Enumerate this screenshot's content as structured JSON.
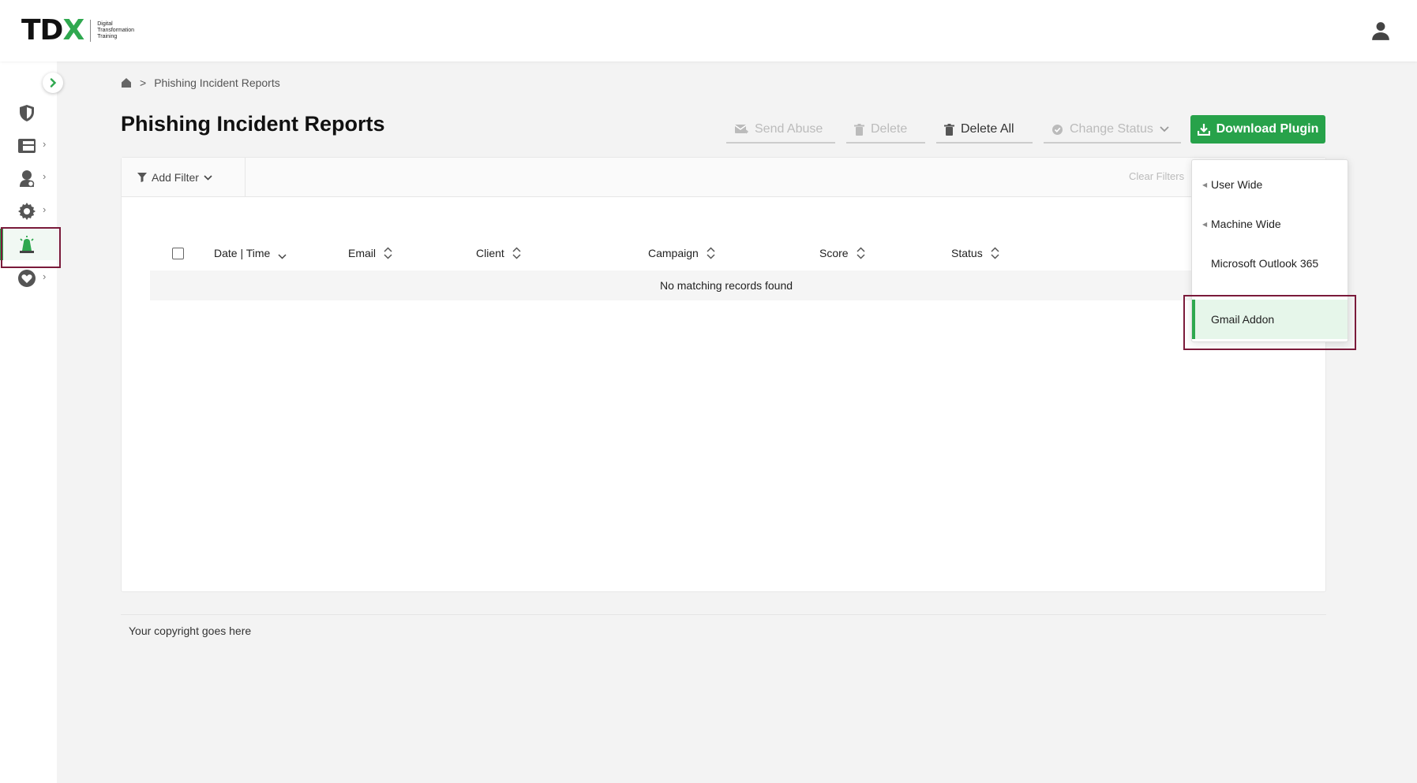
{
  "header": {
    "logo_main": "TD",
    "logo_accent": "X",
    "logo_sub": "Digital Transformation Training",
    "user_icon": "user-icon"
  },
  "sidebar": {
    "collapse_icon": "chevron-right-icon",
    "items": [
      {
        "icon": "shield-icon",
        "has_arrow": false
      },
      {
        "icon": "dashboard-icon",
        "has_arrow": true
      },
      {
        "icon": "user-group-icon",
        "has_arrow": true
      },
      {
        "icon": "gear-icon",
        "has_arrow": true
      },
      {
        "icon": "phishing-alarm-icon",
        "has_arrow": false,
        "active": true
      },
      {
        "icon": "heart-icon",
        "has_arrow": true
      }
    ],
    "arrow_glyph": "›"
  },
  "breadcrumb": {
    "separator": ">",
    "current": "Phishing Incident Reports"
  },
  "page": {
    "title": "Phishing Incident Reports"
  },
  "toolbar": {
    "send_abuse": "Send Abuse",
    "delete": "Delete",
    "delete_all": "Delete All",
    "change_status": "Change Status",
    "download_plugin": "Download Plugin"
  },
  "filters": {
    "add_filter": "Add Filter",
    "clear_filters": "Clear Filters"
  },
  "table": {
    "columns": [
      "Date | Time",
      "Email",
      "Client",
      "Campaign",
      "Score",
      "Status"
    ],
    "empty_message": "No matching records found"
  },
  "dropdown": {
    "items": [
      "User Wide",
      "Machine Wide",
      "Microsoft Outlook 365",
      "Gmail Addon"
    ],
    "selected": "Gmail Addon"
  },
  "footer": {
    "copyright": "Your copyright goes here"
  },
  "colors": {
    "accent": "#27a24a",
    "highlight_border": "#7a1a3a"
  }
}
